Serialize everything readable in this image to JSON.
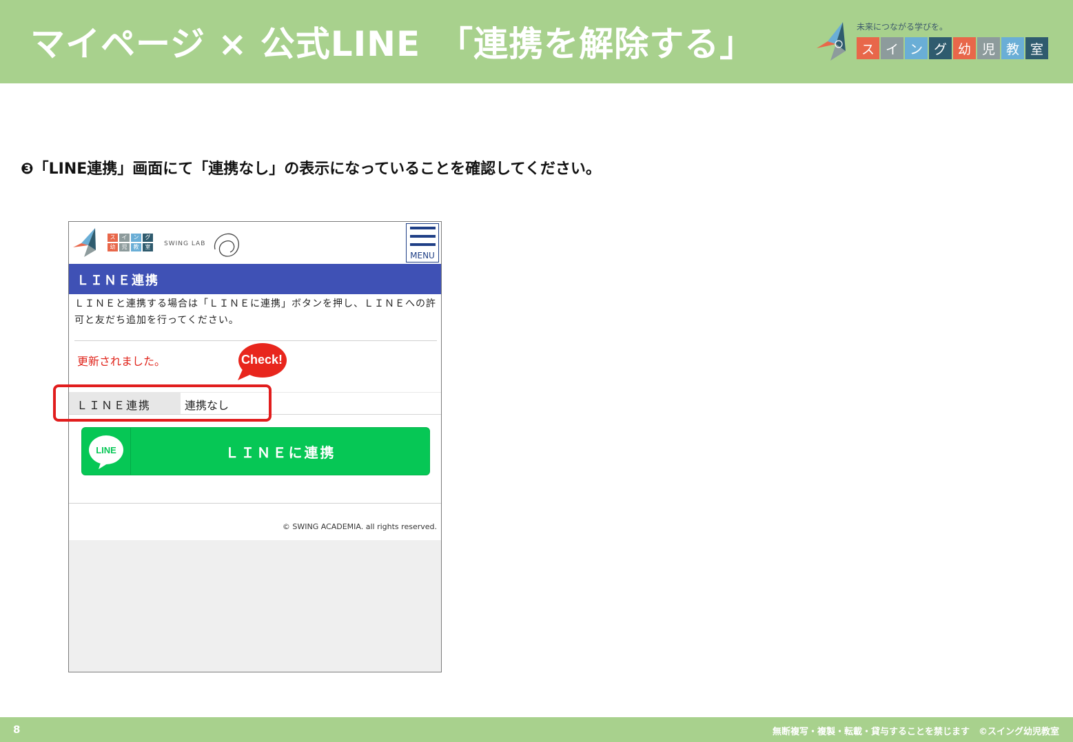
{
  "slide": {
    "title": "マイページ × 公式LINE　「連携を解除する」",
    "instruction": "❸「LINE連携」画面にて「連携なし」の表示になっていることを確認してください。",
    "page_number": "8",
    "footer_note": "無断複写・複製・転載・貸与することを禁じます　©スイング幼児教室"
  },
  "brand": {
    "tagline": "未来につながる学びを。",
    "tiles": [
      {
        "char": "ス",
        "color": "#e8674a"
      },
      {
        "char": "イ",
        "color": "#8d9b9c"
      },
      {
        "char": "ン",
        "color": "#6aaed6"
      },
      {
        "char": "グ",
        "color": "#2f5b6e"
      },
      {
        "char": "幼",
        "color": "#e8674a"
      },
      {
        "char": "児",
        "color": "#8d9b9c"
      },
      {
        "char": "教",
        "color": "#6aaed6"
      },
      {
        "char": "室",
        "color": "#2f5b6e"
      }
    ]
  },
  "phone": {
    "mini_logo_tiles": [
      "ス",
      "イ",
      "ン",
      "グ",
      "幼",
      "児",
      "教",
      "室"
    ],
    "lab_text": "SWING LAB",
    "menu_label": "MENU",
    "section_title": "ＬＩＮＥ連携",
    "description": "ＬＩＮＥと連携する場合は「ＬＩＮＥに連携」ボタンを押し、ＬＩＮＥへの許可と友だち追加を行ってください。",
    "updated_message": "更新されました。",
    "check_label": "Check!",
    "status_key": "ＬＩＮＥ連携",
    "status_value": "連携なし",
    "line_button_label": "ＬＩＮＥに連携",
    "line_icon_text": "LINE",
    "copyright": "© SWING ACADEMIA. all rights reserved."
  },
  "colors": {
    "header_green": "#a8d18d",
    "bar_blue": "#3f51b5",
    "line_green": "#06c755",
    "alert_red": "#e11d1d"
  }
}
